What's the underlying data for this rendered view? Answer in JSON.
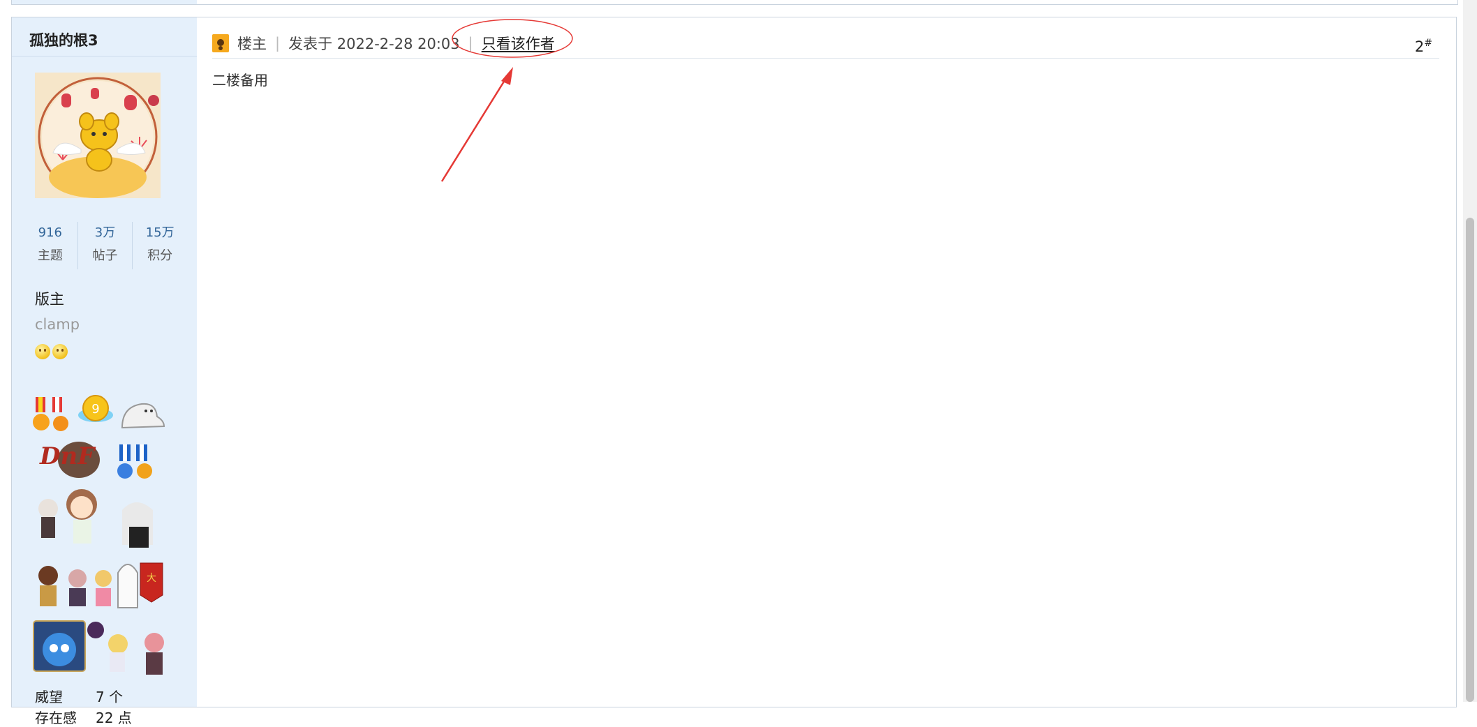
{
  "post": {
    "username": "孤独的根3",
    "stats": [
      {
        "value": "916",
        "label": "主题"
      },
      {
        "value": "3万",
        "label": "帖子"
      },
      {
        "value": "15万",
        "label": "积分"
      }
    ],
    "group": "版主",
    "custom_title": "clamp",
    "star_icons": [
      "smiley-icon",
      "smiley-icon"
    ],
    "info": [
      {
        "key": "威望",
        "value": "7 个"
      },
      {
        "key": "存在感",
        "value": "22 点"
      }
    ],
    "header": {
      "op_label": "楼主",
      "posted_at": "发表于 2022-2-28 20:03",
      "author_only": "只看该作者",
      "floor_number": "2",
      "floor_mark": "#"
    },
    "content": "二楼备用"
  },
  "colors": {
    "sidebar_bg": "#e5f0fb",
    "annotation": "#e53935",
    "link": "#336699"
  }
}
